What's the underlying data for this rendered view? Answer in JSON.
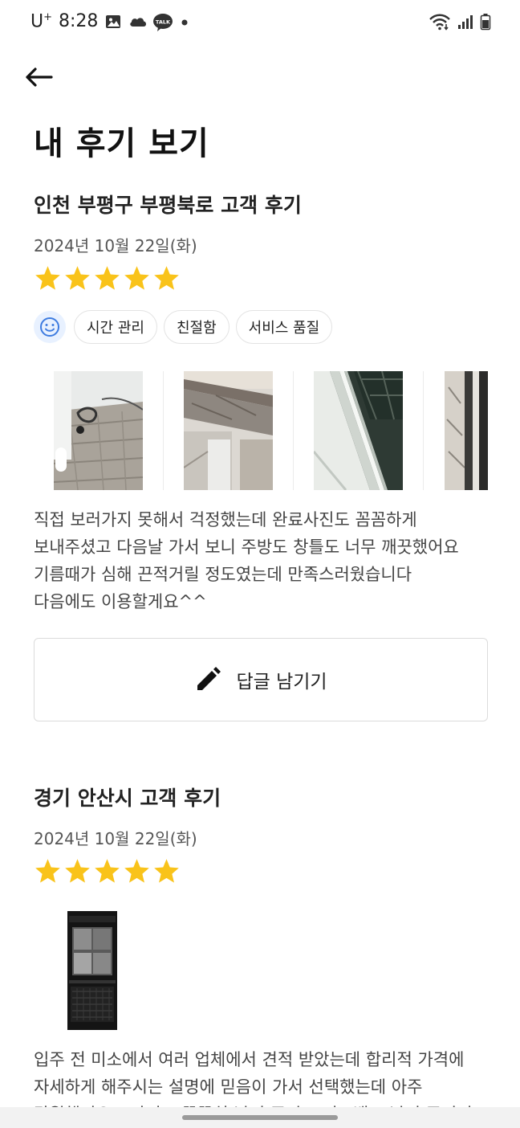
{
  "status_bar": {
    "carrier": "U",
    "carrier_sup": "+",
    "time": "8:28",
    "talk_badge": "TALK",
    "icons": [
      "gallery-icon",
      "cloud-icon",
      "kakaotalk-icon",
      "dot-icon",
      "wifi-icon",
      "signal-icon",
      "battery-icon"
    ]
  },
  "header": {
    "back_icon": "arrow-left-icon",
    "title": "내 후기 보기"
  },
  "reviews": [
    {
      "title": "인천 부평구 부평북로 고객 후기",
      "date": "2024년 10월 22일(화)",
      "rating": 5,
      "tags": [
        "시간 관리",
        "친절함",
        "서비스 품질"
      ],
      "photo_count_visible": 4,
      "text": "직접 보러가지 못해서 걱정했는데 완료사진도 꼼꼼하게\n보내주셨고 다음날 가서 보니 주방도 창틀도 너무 깨끗했어요\n기름때가 심해 끈적거릴 정도였는데 만족스러웠습니다\n다음에도 이용할게요^^",
      "reply_button": "답글 남기기"
    },
    {
      "title": "경기 안산시 고객 후기",
      "date": "2024년 10월 22일(화)",
      "rating": 5,
      "photo_count_visible": 1,
      "text": "입주 전 미소에서 여러 업체에서 견적 받았는데 합리적 가격에\n자세하게 해주시는 설명에 믿음이 가서 선택했는데 아주\n탁월했어요!! 사진도 꼼꼼히 남겨 주시고 피드백도 남겨 주셔서"
    }
  ],
  "colors": {
    "star": "#F9C31A",
    "smile_bg": "#E8F1FF",
    "smile_stroke": "#3D7BE0"
  }
}
